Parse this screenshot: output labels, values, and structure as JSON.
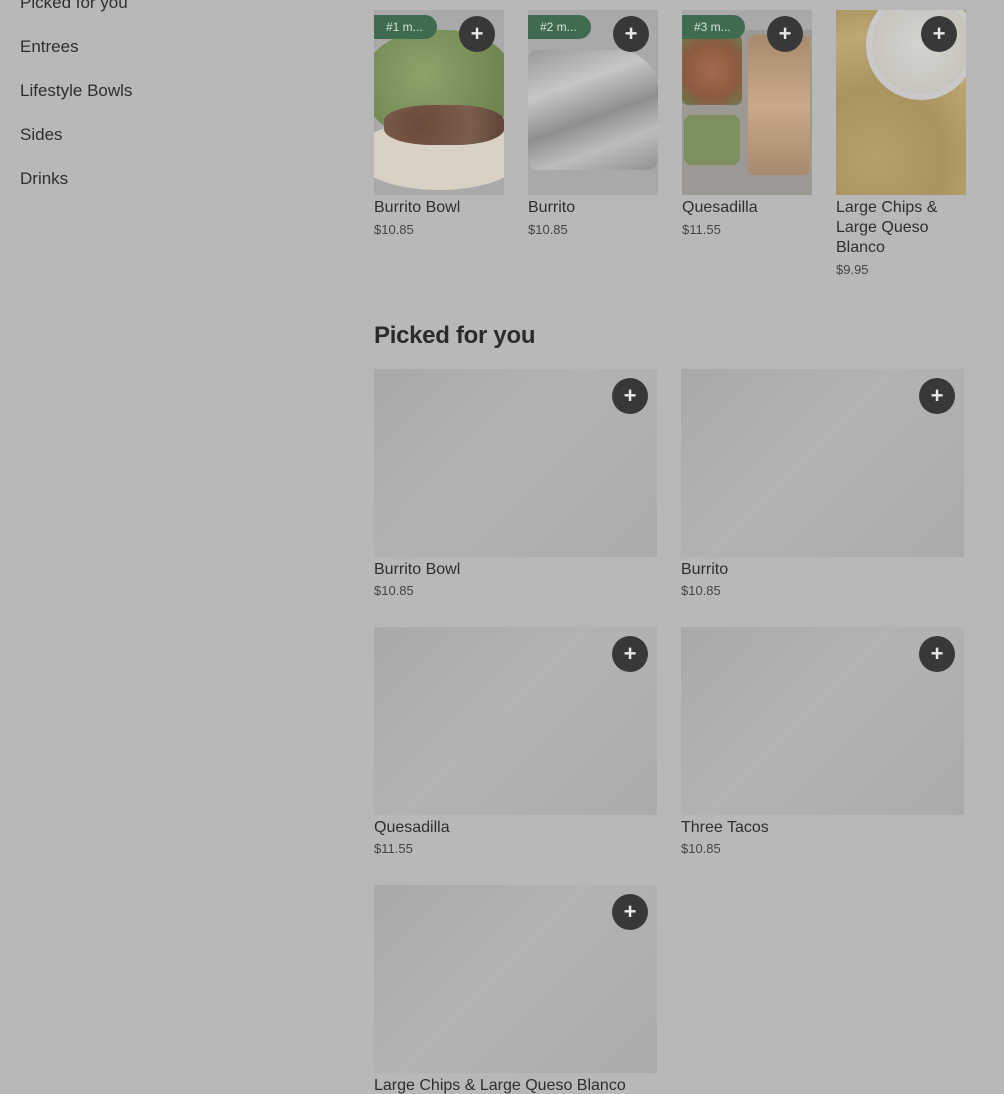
{
  "sidebar": {
    "items": [
      "Picked for you",
      "Entrees",
      "Lifestyle Bowls",
      "Sides",
      "Drinks"
    ]
  },
  "top_items": [
    {
      "badge": "#1 m...",
      "name": "Burrito Bowl",
      "price": "$10.85"
    },
    {
      "badge": "#2 m...",
      "name": "Burrito",
      "price": "$10.85"
    },
    {
      "badge": "#3 m...",
      "name": "Quesadilla",
      "price": "$11.55"
    },
    {
      "badge": "",
      "name": "Large Chips & Large Queso Blanco",
      "price": "$9.95"
    }
  ],
  "section": {
    "title": "Picked for you"
  },
  "picked_items": [
    {
      "name": "Burrito Bowl",
      "price": "$10.85"
    },
    {
      "name": "Burrito",
      "price": "$10.85"
    },
    {
      "name": "Quesadilla",
      "price": "$11.55"
    },
    {
      "name": "Three Tacos",
      "price": "$10.85"
    },
    {
      "name": "Large Chips & Large Queso Blanco",
      "price": ""
    }
  ],
  "add_button": {
    "label": "+"
  },
  "colors": {
    "overlay": "#b8b8b8",
    "badge": "#3f6b50",
    "button": "#383838"
  }
}
